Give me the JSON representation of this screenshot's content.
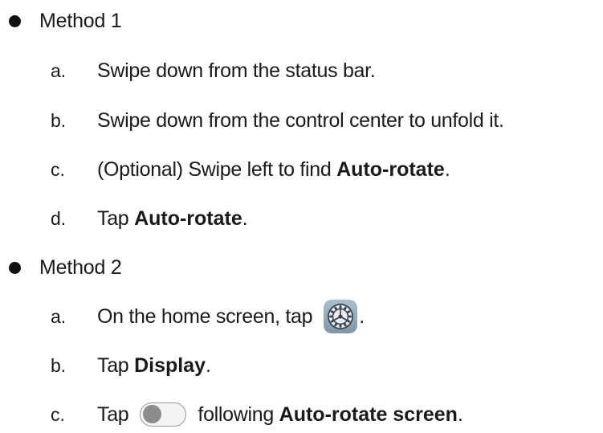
{
  "methods": [
    {
      "label": "Method 1",
      "steps": [
        {
          "letter": "a.",
          "text": "Swipe down from the status bar."
        },
        {
          "letter": "b.",
          "text": "Swipe down from the control center to unfold it."
        },
        {
          "letter": "c.",
          "text_before": "(Optional) Swipe left to find ",
          "bold": "Auto-rotate",
          "text_after": "."
        },
        {
          "letter": "d.",
          "text_before": "Tap ",
          "bold": "Auto-rotate",
          "text_after": "."
        }
      ]
    },
    {
      "label": "Method 2",
      "steps": [
        {
          "letter": "a.",
          "text_before": "On the home screen, tap",
          "icon": "settings-gear-icon",
          "text_after": "."
        },
        {
          "letter": "b.",
          "text_before": "Tap ",
          "bold": "Display",
          "text_after": "."
        },
        {
          "letter": "c.",
          "text_before": "Tap",
          "icon": "toggle-switch-off-icon",
          "text_middle": "following ",
          "bold": "Auto-rotate screen",
          "text_after": "."
        }
      ]
    }
  ]
}
